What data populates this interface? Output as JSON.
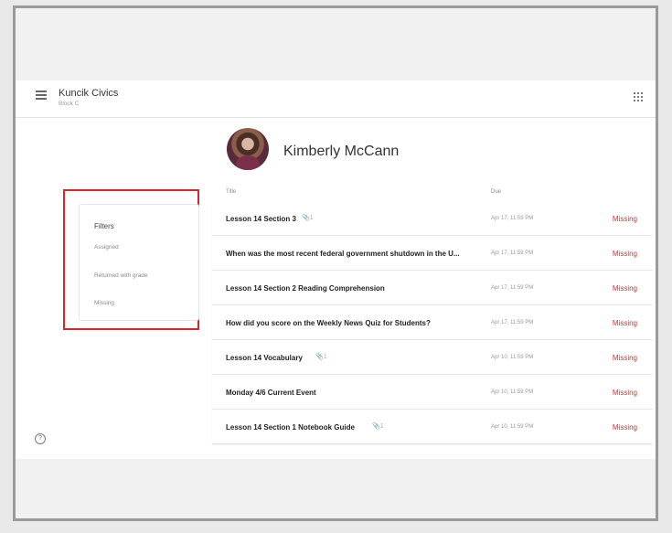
{
  "header": {
    "class_name": "Kuncik Civics",
    "section": "Block C",
    "menu_icon": "hamburger-menu-icon",
    "apps_icon": "apps-grid-icon"
  },
  "filters": {
    "title": "Filters",
    "items": [
      "Assigned",
      "Returned with grade",
      "Missing"
    ]
  },
  "student": {
    "name": "Kimberly McCann"
  },
  "columns": {
    "title": "Title",
    "due": "Due"
  },
  "assignments": [
    {
      "title": "Lesson 14 Section 3",
      "attachments": "1",
      "due": "Apr 17, 11:59 PM",
      "status": "Missing"
    },
    {
      "title": "When was the most recent federal government shutdown in the U...",
      "attachments": "",
      "due": "Apr 17, 11:59 PM",
      "status": "Missing"
    },
    {
      "title": "Lesson 14 Section 2 Reading Comprehension",
      "attachments": "",
      "due": "Apr 17, 11:59 PM",
      "status": "Missing"
    },
    {
      "title": "How did you score on the Weekly News Quiz for Students?",
      "attachments": "",
      "due": "Apr 17, 11:59 PM",
      "status": "Missing"
    },
    {
      "title": "Lesson 14 Vocabulary",
      "attachments": "1",
      "due": "Apr 10, 11:59 PM",
      "status": "Missing"
    },
    {
      "title": "Monday 4/6 Current Event",
      "attachments": "",
      "due": "Apr 10, 11:59 PM",
      "status": "Missing"
    },
    {
      "title": "Lesson 14 Section 1 Notebook Guide",
      "attachments": "1",
      "due": "Apr 10, 11:59 PM",
      "status": "Missing"
    }
  ],
  "colors": {
    "missing": "#d93025",
    "highlight_border": "#d8262c"
  },
  "help": {
    "icon": "help-icon",
    "glyph": "?"
  }
}
